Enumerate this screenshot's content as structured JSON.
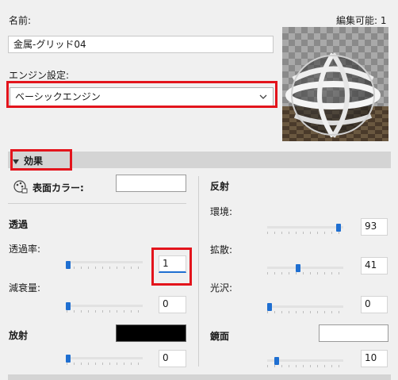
{
  "header": {
    "name_label": "名前:",
    "editable_label": "編集可能: 1"
  },
  "name_field": {
    "value": "金属-グリッド04"
  },
  "engine": {
    "label": "エンジン設定:",
    "selected": "ベーシックエンジン"
  },
  "effects": {
    "title": "効果",
    "surface_color_label": "表面カラー:",
    "transparency_heading": "透過",
    "transparency_label": "透過率:",
    "transparency_value": "1",
    "transparency_level": 1,
    "attenuation_label": "減衰量:",
    "attenuation_value": "0",
    "attenuation_level": 0,
    "emission_label": "放射",
    "emission_value": "0",
    "emission_level": 0,
    "emission_color": "#000000",
    "reflection_heading": "反射",
    "ambient_label": "環境:",
    "ambient_value": "93",
    "ambient_level": 93,
    "diffuse_label": "拡散:",
    "diffuse_value": "41",
    "diffuse_level": 41,
    "gloss_label": "光沢:",
    "gloss_value": "0",
    "gloss_level": 0,
    "specular_label": "鏡面",
    "specular_value": "10",
    "specular_level": 10,
    "surface_color": "#ffffff",
    "specular_color": "#ffffff"
  },
  "colors": {
    "accent": "#1f6fd1",
    "highlight": "#e3141c"
  }
}
